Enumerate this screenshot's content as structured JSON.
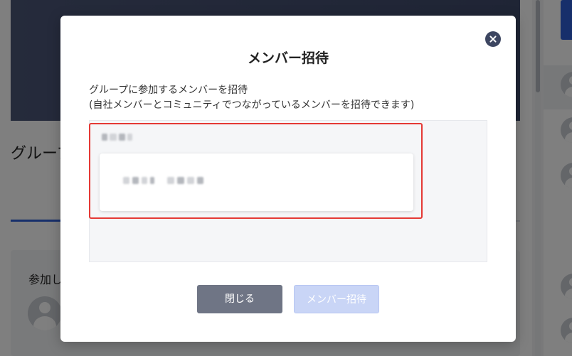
{
  "background_page": {
    "group_title": "グループ",
    "participating_label": "参加し"
  },
  "modal": {
    "title": "メンバー招待",
    "description_line1": "グループに参加するメンバーを招待",
    "description_line2": "(自社メンバーとコミュニティでつながっているメンバーを招待できます)",
    "invite_list": {
      "section_label": "",
      "member_name": ""
    },
    "buttons": {
      "close_label": "閉じる",
      "invite_label": "メンバー招待",
      "invite_enabled": false
    },
    "colors": {
      "highlight_border": "#e53935",
      "close_button": "#6f7585",
      "invite_button_disabled": "#c9d5f6",
      "close_icon_bg": "#3d4661"
    }
  },
  "icons": {
    "modal_close": "close-icon",
    "avatar": "user-avatar-icon"
  }
}
